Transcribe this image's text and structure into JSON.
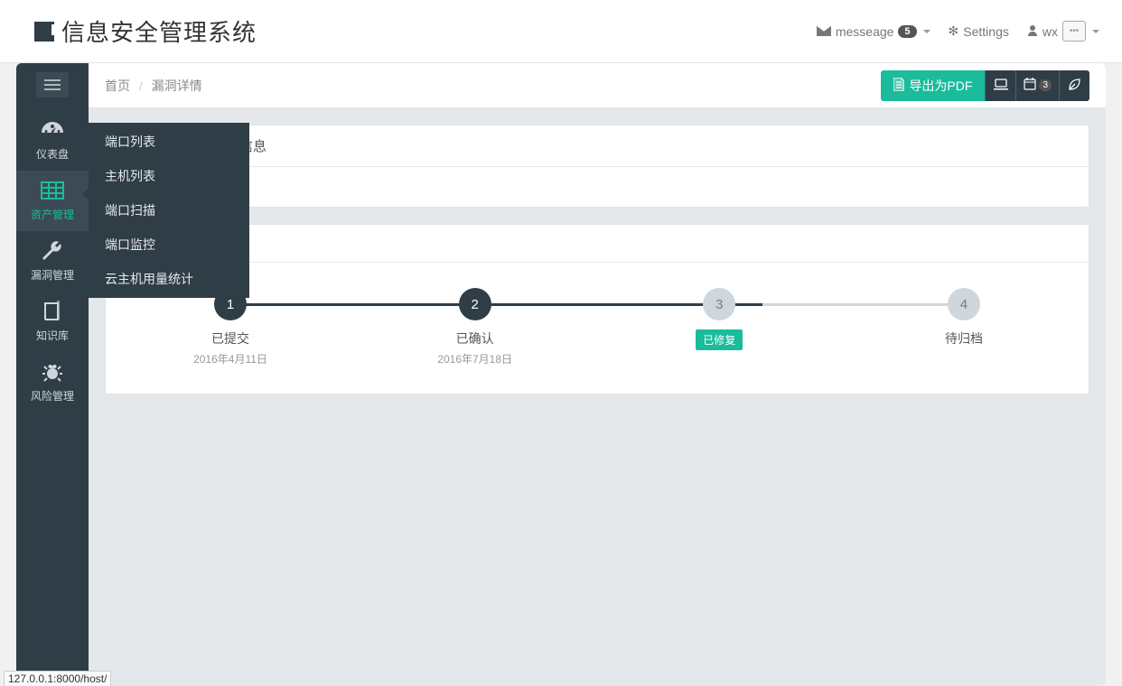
{
  "app": {
    "title": "信息安全管理系统"
  },
  "header": {
    "messages": {
      "label": "messeage",
      "count": "5"
    },
    "settings": "Settings",
    "user": "wx"
  },
  "sidebar": {
    "items": [
      {
        "label": "仪表盘"
      },
      {
        "label": "资产管理"
      },
      {
        "label": "漏洞管理"
      },
      {
        "label": "知识库"
      },
      {
        "label": "风险管理"
      }
    ],
    "submenu": [
      "端口列表",
      "主机列表",
      "端口扫描",
      "端口监控",
      "云主机用量统计"
    ]
  },
  "breadcrumb": {
    "home": "首页",
    "current": "漏洞详情"
  },
  "topbar": {
    "exportPdf": "导出为PDF",
    "cal_badge": "3"
  },
  "panel1": {
    "title_suffix": "E信息",
    "title_visible": "E信息"
  },
  "panel2": {
    "title": ""
  },
  "steps": [
    {
      "num": "1",
      "title": "已提交",
      "date": "2016年4月11日",
      "state": "done"
    },
    {
      "num": "2",
      "title": "已确认",
      "date": "2016年7月18日",
      "state": "done"
    },
    {
      "num": "3",
      "badge": "已修复",
      "state": "todo"
    },
    {
      "num": "4",
      "title": "待归档",
      "state": "todo"
    }
  ],
  "status_url": "127.0.0.1:8000/host/"
}
